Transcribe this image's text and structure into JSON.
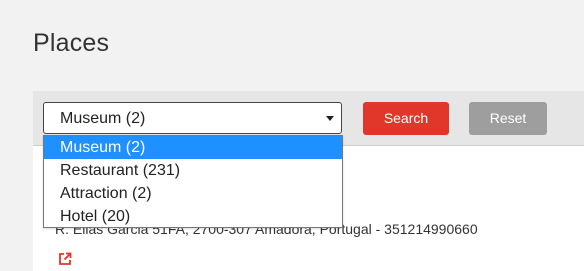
{
  "page": {
    "title": "Places"
  },
  "filter": {
    "selected": "Museum (2)",
    "options": [
      "Museum (2)",
      "Restaurant (231)",
      "Attraction (2)",
      "Hotel (20)"
    ],
    "search_label": "Search",
    "reset_label": "Reset"
  },
  "result": {
    "address": "R. Elias Garcia 51FA, 2700-307 Amadora, Portugal  -  351214990660",
    "link_icon": "external-link-icon"
  },
  "colors": {
    "search_button": "#e0372a",
    "reset_button": "#9e9e9e",
    "selected_option": "#1e90ff",
    "link_icon": "#e0372a"
  }
}
